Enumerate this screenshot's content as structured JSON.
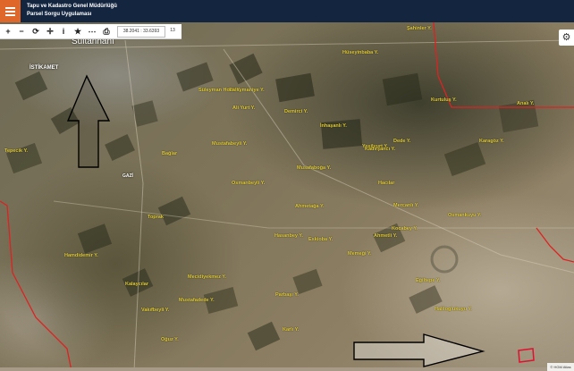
{
  "header": {
    "title_line1": "Tapu ve Kadastro Genel Müdürlüğü",
    "title_line2": "Parsel Sorgu Uygulaması"
  },
  "toolbar": {
    "zoom_in": "+",
    "zoom_out": "−",
    "refresh": "⟳",
    "locate": "✛",
    "info": "i",
    "favorite": "★",
    "measure": "⋯",
    "print": "⎙",
    "coordinates": "38.2041 : 33.6393",
    "zoom_level": "13"
  },
  "settings_icon": "⚙",
  "map": {
    "places": {
      "sultanhani": "Sultanhanı",
      "istikamet": "İSTİKAMET",
      "gazi": "GAZİ"
    },
    "labels": [
      "Şahinler Y.",
      "Hüseyinbaba Y.",
      "Süleymaniye Y.",
      "Ali Yurt Y.",
      "Demirci Y.",
      "Analı Y.",
      "Süleyman Hoca Y.",
      "Kurtuluş Y.",
      "Dede Y.",
      "İnhaşanlı Y.",
      "Mustafabeyli Y.",
      "Karagöz Y.",
      "Yeşilyurt Y.",
      "Kadırşancı Y.",
      "Tepecik Y.",
      "Bağlar",
      "Musafaboğa Y.",
      "Hacılar",
      "Osmanbeyli Y.",
      "Ahmetağa Y.",
      "Mercanlı Y.",
      "Osmankuyu Y.",
      "Toprak",
      "Kocabey Y.",
      "Eskioba Y.",
      "Ahmetli Y.",
      "Hasanbey Y.",
      "Memeği Y.",
      "Hamdidemir Y.",
      "Kalaycılar",
      "Mecidiyekmez Y.",
      "Parbaşı Y.",
      "Eğiltepe Y.",
      "Mustafadede Y.",
      "Haliloglukuyu Y.",
      "Vakıfbeyli Y.",
      "Karlı Y.",
      "Oğuz Y."
    ],
    "attribution": "© HGM Atlas"
  }
}
